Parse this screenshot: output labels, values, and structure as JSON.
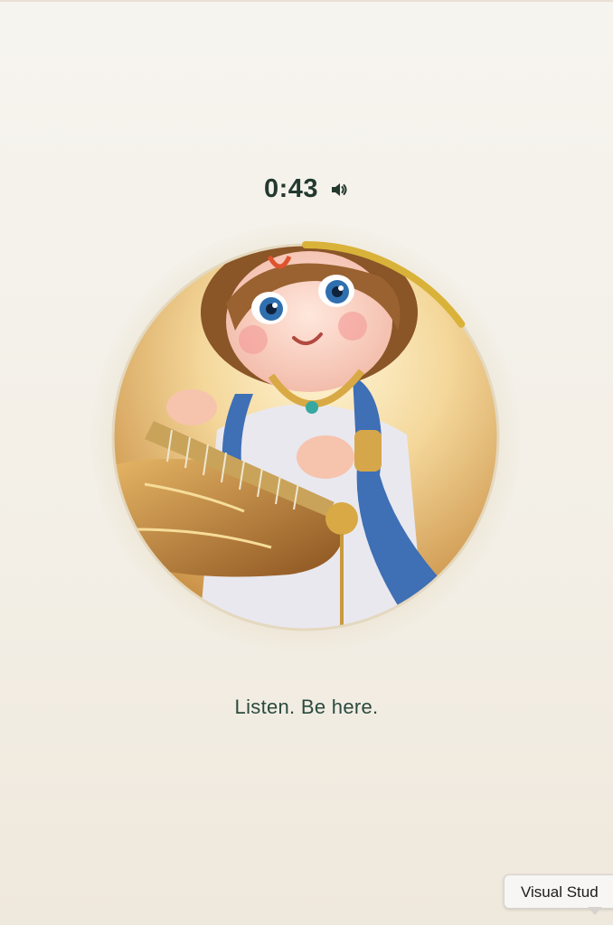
{
  "timer": {
    "display": "0:43",
    "icon": "speaker-icon"
  },
  "artwork": {
    "subject": "illustration",
    "progress_fraction": 0.15,
    "progress_color": "#d9b23a"
  },
  "caption": "Listen. Be here.",
  "tooltip": {
    "label": "Visual Stud"
  },
  "colors": {
    "text_primary": "#23392f",
    "background": "#f5f2eb"
  }
}
